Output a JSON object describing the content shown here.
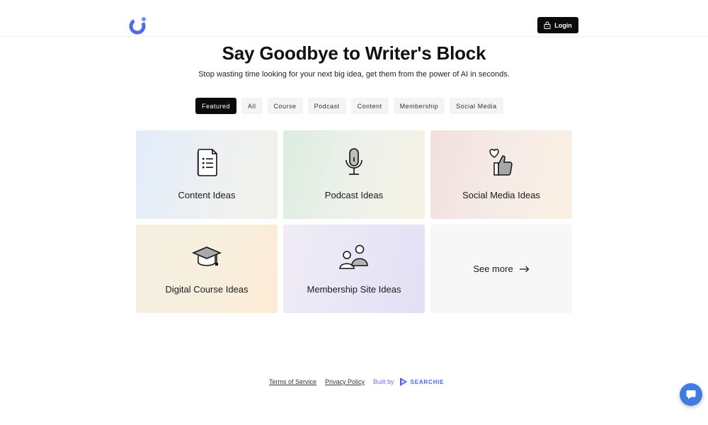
{
  "header": {
    "login_label": "Login"
  },
  "hero": {
    "title": "Say Goodbye to Writer's Block",
    "subtitle": "Stop wasting time looking for your next big idea, get them from the power of AI in seconds."
  },
  "tabs": [
    {
      "label": "Featured",
      "active": true
    },
    {
      "label": "All",
      "active": false
    },
    {
      "label": "Course",
      "active": false
    },
    {
      "label": "Podcast",
      "active": false
    },
    {
      "label": "Content",
      "active": false
    },
    {
      "label": "Membership",
      "active": false
    },
    {
      "label": "Social Media",
      "active": false
    }
  ],
  "cards": [
    {
      "label": "Content Ideas",
      "icon": "document-list-icon"
    },
    {
      "label": "Podcast Ideas",
      "icon": "microphone-icon"
    },
    {
      "label": "Social Media Ideas",
      "icon": "heart-thumbs-up-icon"
    },
    {
      "label": "Digital Course Ideas",
      "icon": "graduation-cap-icon"
    },
    {
      "label": "Membership Site Ideas",
      "icon": "people-icon"
    }
  ],
  "see_more": {
    "label": "See more",
    "icon": "arrow-right-icon"
  },
  "footer": {
    "terms": "Terms of Service",
    "privacy": "Privacy Policy",
    "built_by": "Built by",
    "brand": "SEARCHIE"
  },
  "colors": {
    "accent": "#0b0b0b",
    "logo": "#5468e8",
    "chat": "#3f7be0"
  }
}
